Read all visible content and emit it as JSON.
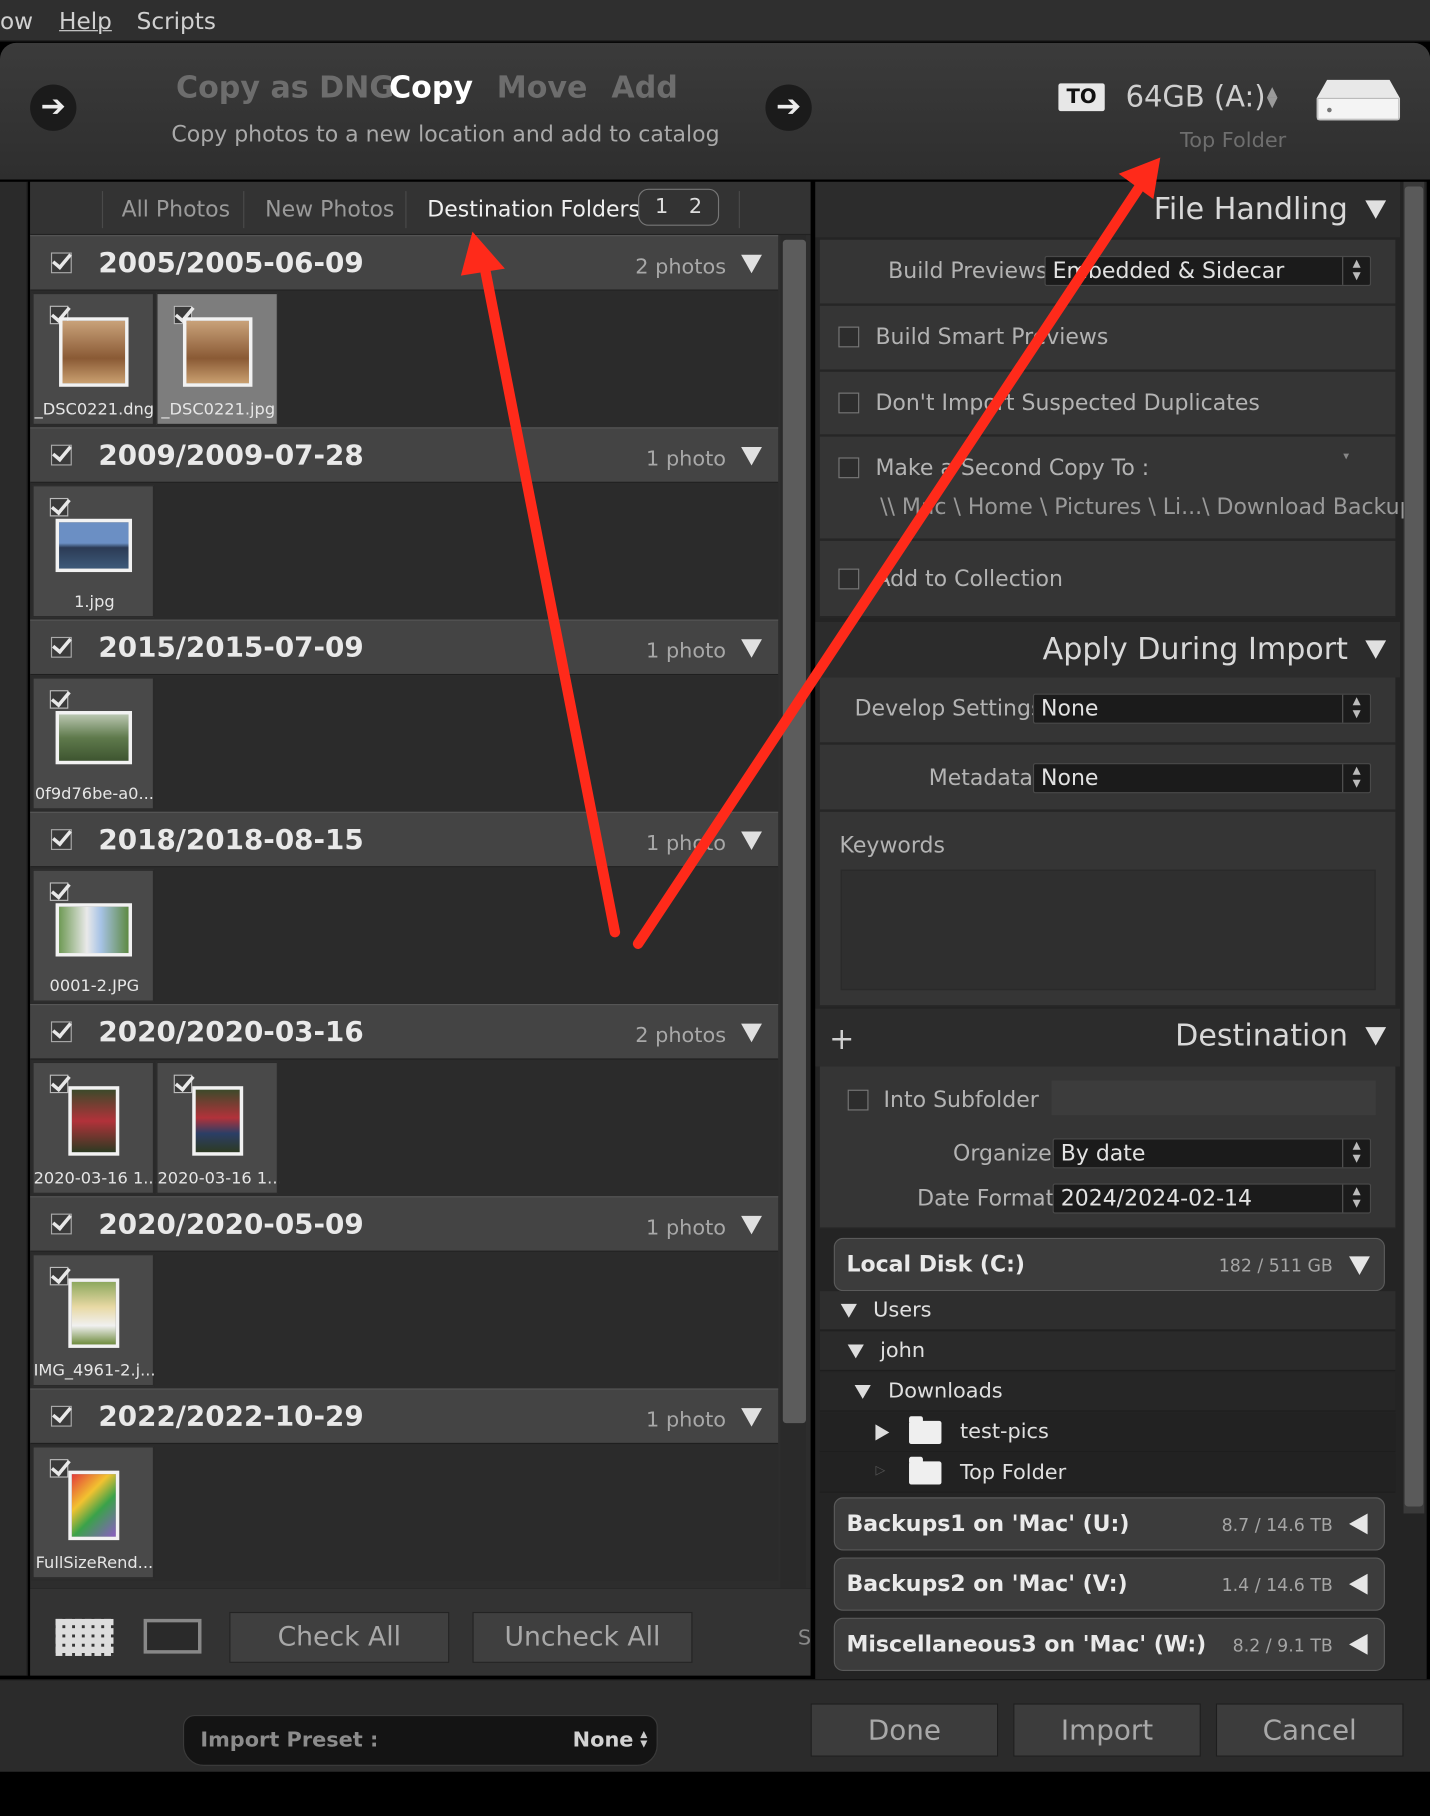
{
  "menu": {
    "items": [
      "ow",
      "Help",
      "Scripts"
    ]
  },
  "header": {
    "modes": [
      "Copy as DNG",
      "Copy",
      "Move",
      "Add"
    ],
    "active_mode": "Copy",
    "subtitle": "Copy photos to a new location and add to catalog",
    "to_label": "TO",
    "drive": "64GB (A:)",
    "drive_sub": "Top Folder"
  },
  "tabs": {
    "all": "All Photos",
    "new": "New Photos",
    "dest": "Destination Folders",
    "pages": "1 2"
  },
  "groups": [
    {
      "title": "2005/2005-06-09",
      "count": "2 photos",
      "thumbs": [
        {
          "name": "_DSC0221.dng",
          "selected": false
        },
        {
          "name": "_DSC0221.jpg",
          "selected": true
        }
      ]
    },
    {
      "title": "2009/2009-07-28",
      "count": "1 photo",
      "thumbs": [
        {
          "name": "1.jpg",
          "selected": false
        }
      ]
    },
    {
      "title": "2015/2015-07-09",
      "count": "1 photo",
      "thumbs": [
        {
          "name": "0f9d76be-a0...",
          "selected": false
        }
      ]
    },
    {
      "title": "2018/2018-08-15",
      "count": "1 photo",
      "thumbs": [
        {
          "name": "0001-2.JPG",
          "selected": false
        }
      ]
    },
    {
      "title": "2020/2020-03-16",
      "count": "2 photos",
      "thumbs": [
        {
          "name": "2020-03-16 1...",
          "selected": false
        },
        {
          "name": "2020-03-16 1...",
          "selected": false
        }
      ]
    },
    {
      "title": "2020/2020-05-09",
      "count": "1 photo",
      "thumbs": [
        {
          "name": "IMG_4961-2.j...",
          "selected": false
        }
      ]
    },
    {
      "title": "2022/2022-10-29",
      "count": "1 photo",
      "thumbs": [
        {
          "name": "FullSizeRend...",
          "selected": false
        }
      ]
    }
  ],
  "left_bottom": {
    "check_all": "Check All",
    "uncheck_all": "Uncheck All",
    "cut_letter": "S"
  },
  "file_handling": {
    "title": "File Handling",
    "build_previews_label": "Build Previews",
    "build_previews_value": "Embedded & Sidecar",
    "smart_previews": "Build Smart Previews",
    "no_duplicates": "Don't Import Suspected Duplicates",
    "second_copy": "Make a Second Copy To :",
    "second_copy_path": "\\\\ Mac \\ Home \\ Pictures \\ Li...\\ Download Backups",
    "add_collection": "Add to Collection"
  },
  "apply": {
    "title": "Apply During Import",
    "develop_label": "Develop Settings",
    "develop_value": "None",
    "metadata_label": "Metadata",
    "metadata_value": "None",
    "keywords_label": "Keywords"
  },
  "destination": {
    "title": "Destination",
    "plus": "+",
    "subfolder": "Into Subfolder",
    "organize_label": "Organize",
    "organize_value": "By date",
    "date_format_label": "Date Format",
    "date_format_value": "2024/2024-02-14",
    "volumes": [
      {
        "name": "Local Disk (C:)",
        "size": "182 / 511 GB"
      },
      {
        "name": "Backups1 on 'Mac' (U:)",
        "size": "8.7 / 14.6 TB"
      },
      {
        "name": "Backups2 on 'Mac' (V:)",
        "size": "1.4 / 14.6 TB"
      },
      {
        "name": "Miscellaneous3 on 'Mac' (W:)",
        "size": "8.2 / 9.1 TB"
      }
    ],
    "tree": {
      "users": "Users",
      "john": "john",
      "downloads": "Downloads",
      "test_pics": "test-pics",
      "top_folder": "Top Folder"
    }
  },
  "bottom": {
    "preset_label": "Import Preset :",
    "preset_value": "None",
    "done": "Done",
    "import": "Import",
    "cancel": "Cancel"
  },
  "colors": {
    "annotation_arrow": "#ff2a1a",
    "panel_bg": "#2d2d2d",
    "header_bg": "#444444"
  }
}
